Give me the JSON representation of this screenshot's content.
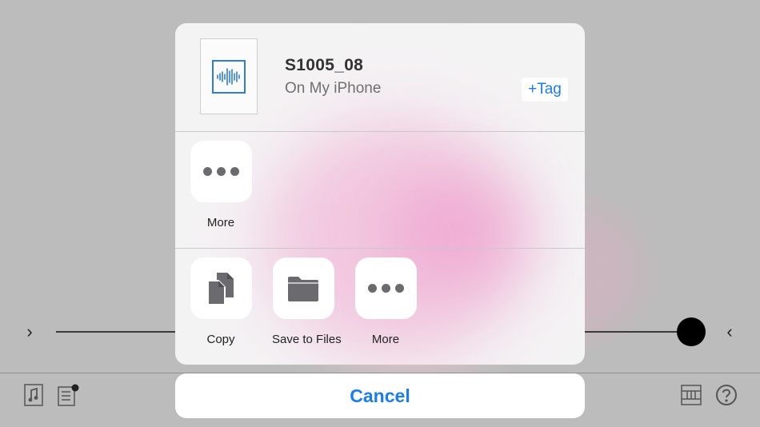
{
  "file": {
    "name": "S1005_08",
    "location": "On My iPhone",
    "tag_label": "+Tag"
  },
  "apps_row": [
    {
      "label": "More",
      "icon": "more-icon"
    }
  ],
  "actions_row": [
    {
      "label": "Copy",
      "icon": "copy-icon"
    },
    {
      "label": "Save to Files",
      "icon": "folder-icon"
    },
    {
      "label": "More",
      "icon": "more-icon"
    }
  ],
  "cancel_label": "Cancel",
  "colors": {
    "accent": "#1a7cf3",
    "icon_gray": "#6a6a6f",
    "waveform": "#2d7de0"
  }
}
